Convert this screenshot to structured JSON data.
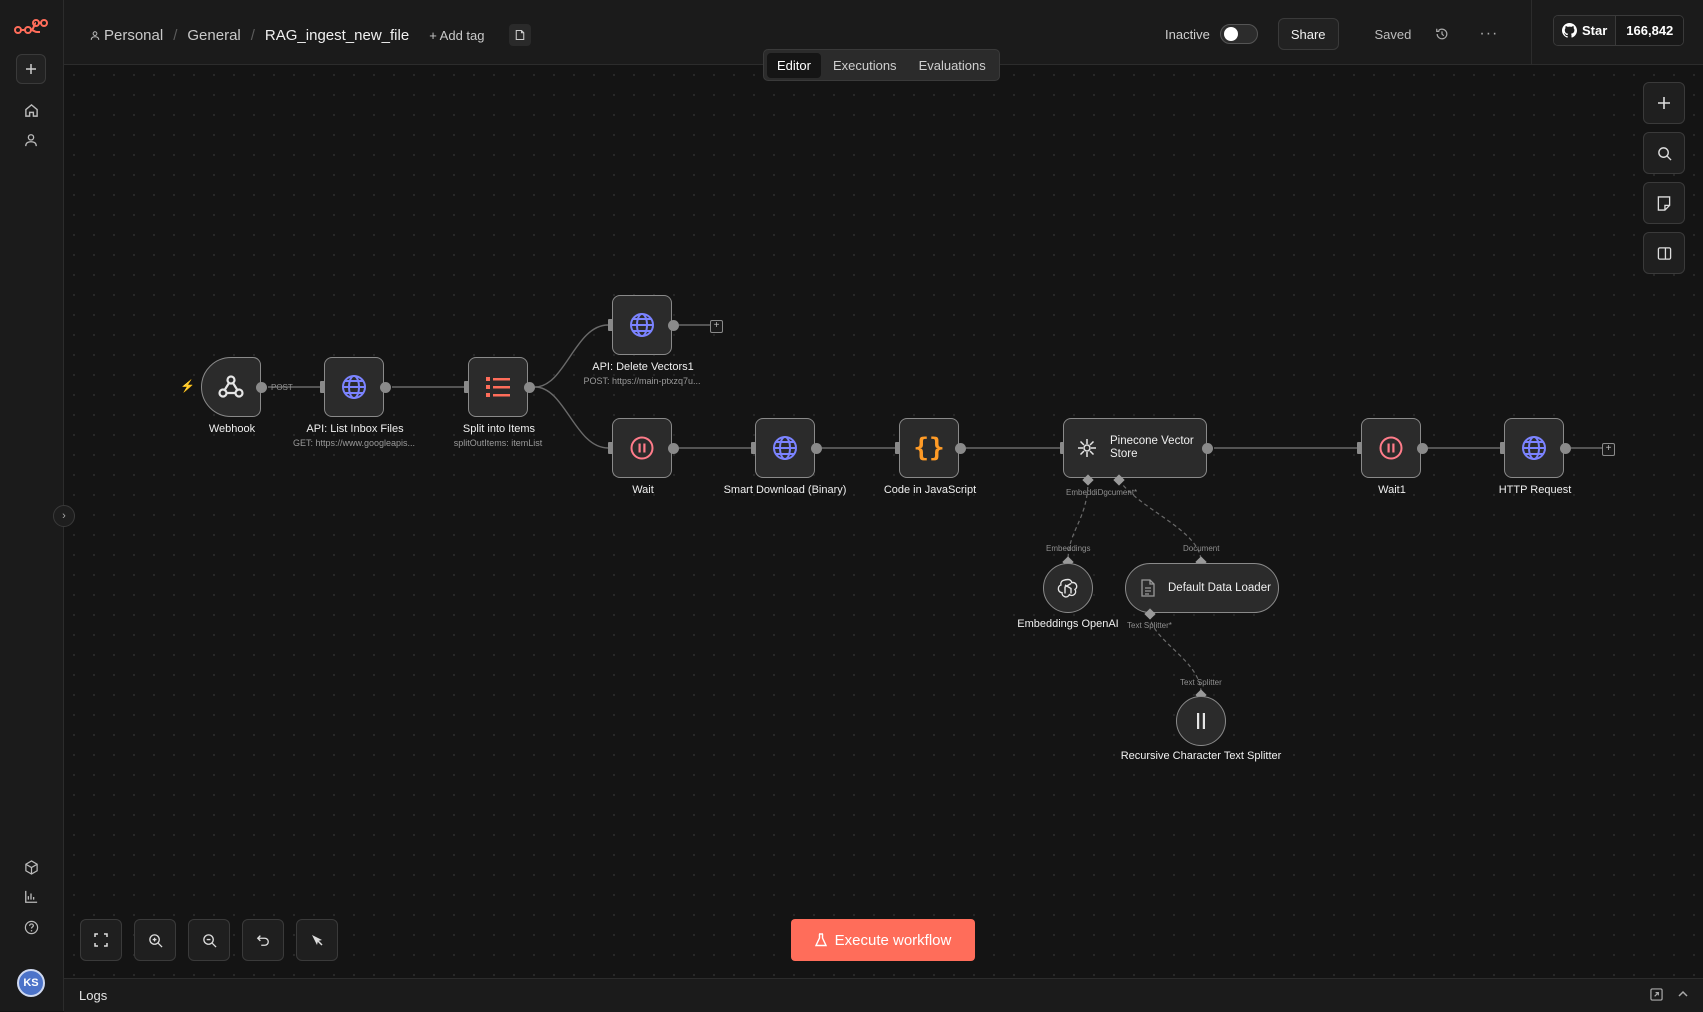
{
  "sidebar": {
    "logo": "n8n-logo-icon",
    "user_initials": "KS",
    "items": [
      "plus-icon",
      "home-icon",
      "user-icon",
      "templates-icon",
      "insights-icon",
      "help-icon"
    ]
  },
  "breadcrumb": {
    "project": "Personal",
    "folder": "General",
    "workflow_name": "RAG_ingest_new_file",
    "add_tag": "+ Add tag"
  },
  "header": {
    "status_label": "Inactive",
    "active": false,
    "share_label": "Share",
    "saved_label": "Saved",
    "more_label": "···"
  },
  "github": {
    "star_label": "Star",
    "star_count": "166,842"
  },
  "tabs": [
    {
      "label": "Editor",
      "active": true
    },
    {
      "label": "Executions",
      "active": false
    },
    {
      "label": "Evaluations",
      "active": false
    }
  ],
  "nodes": {
    "webhook": {
      "label": "Webhook",
      "edge_label": "POST"
    },
    "list_inbox": {
      "label": "API: List Inbox Files",
      "sub": "GET: https://www.googleapis..."
    },
    "split": {
      "label": "Split into Items",
      "sub": "splitOutItems: itemList"
    },
    "delete_vectors": {
      "label": "API: Delete Vectors1",
      "sub": "POST: https://main-ptxzq7u..."
    },
    "wait": {
      "label": "Wait"
    },
    "smart_download": {
      "label": "Smart Download (Binary)"
    },
    "code_js": {
      "label": "Code in JavaScript"
    },
    "pinecone": {
      "label": "Pinecone Vector Store",
      "port_labels": "EmbeddiDgcument*"
    },
    "wait1": {
      "label": "Wait1"
    },
    "http": {
      "label": "HTTP Request"
    },
    "embeddings": {
      "label": "Embeddings OpenAI",
      "port_label": "Embeddings"
    },
    "loader": {
      "label": "Default Data Loader",
      "port_label": "Document",
      "out_label": "Text Splitter*"
    },
    "splitter": {
      "label": "Recursive Character Text Splitter",
      "port_label": "Text Splitter"
    }
  },
  "execute_label": "Execute workflow",
  "logs_label": "Logs",
  "colors": {
    "accent": "#ff6d5a",
    "http_icon": "#7b83ff",
    "wait_icon": "#ff7c8a",
    "code_icon": "#ff9b26"
  }
}
